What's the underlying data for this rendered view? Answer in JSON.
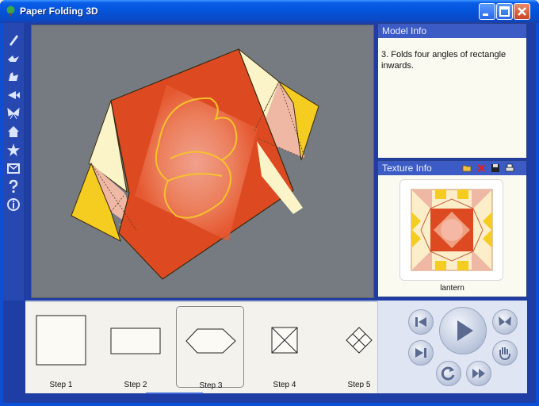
{
  "window": {
    "title": "Paper Folding 3D",
    "app_icon": "tree-icon",
    "buttons": [
      "minimize-icon",
      "maximize-icon",
      "close-icon"
    ]
  },
  "toolbar": {
    "tools": [
      "pen-icon",
      "bird-icon",
      "rooster-icon",
      "fish-icon",
      "butterfly-icon",
      "house-icon",
      "star-icon",
      "box-icon",
      "help-icon",
      "info-icon"
    ]
  },
  "model_info": {
    "header": "Model Info",
    "description": "3. Folds four angles of rectangle inwards."
  },
  "texture_info": {
    "header": "Texture Info",
    "icons": [
      "open-folder-icon",
      "delete-icon",
      "save-icon",
      "print-icon"
    ],
    "texture_name": "lantern"
  },
  "steps": [
    {
      "label": "Step 1",
      "shape": "square"
    },
    {
      "label": "Step 2",
      "shape": "rectangle"
    },
    {
      "label": "Step 3",
      "shape": "hexagon",
      "selected": true
    },
    {
      "label": "Step 4",
      "shape": "crossed-square"
    },
    {
      "label": "Step 5",
      "shape": "diamond"
    }
  ],
  "playback": {
    "buttons": [
      "skip-first-icon",
      "play-icon",
      "butterfly-icon",
      "skip-last-icon",
      "replay-icon",
      "fast-forward-icon",
      "hand-icon"
    ]
  },
  "colors": {
    "paper_face": "#dd4a22",
    "paper_edge": "#fbf4c8",
    "paper_corner": "#f5cc20",
    "viewport_bg": "#757b80",
    "panel_header": "#3c5bc4"
  }
}
